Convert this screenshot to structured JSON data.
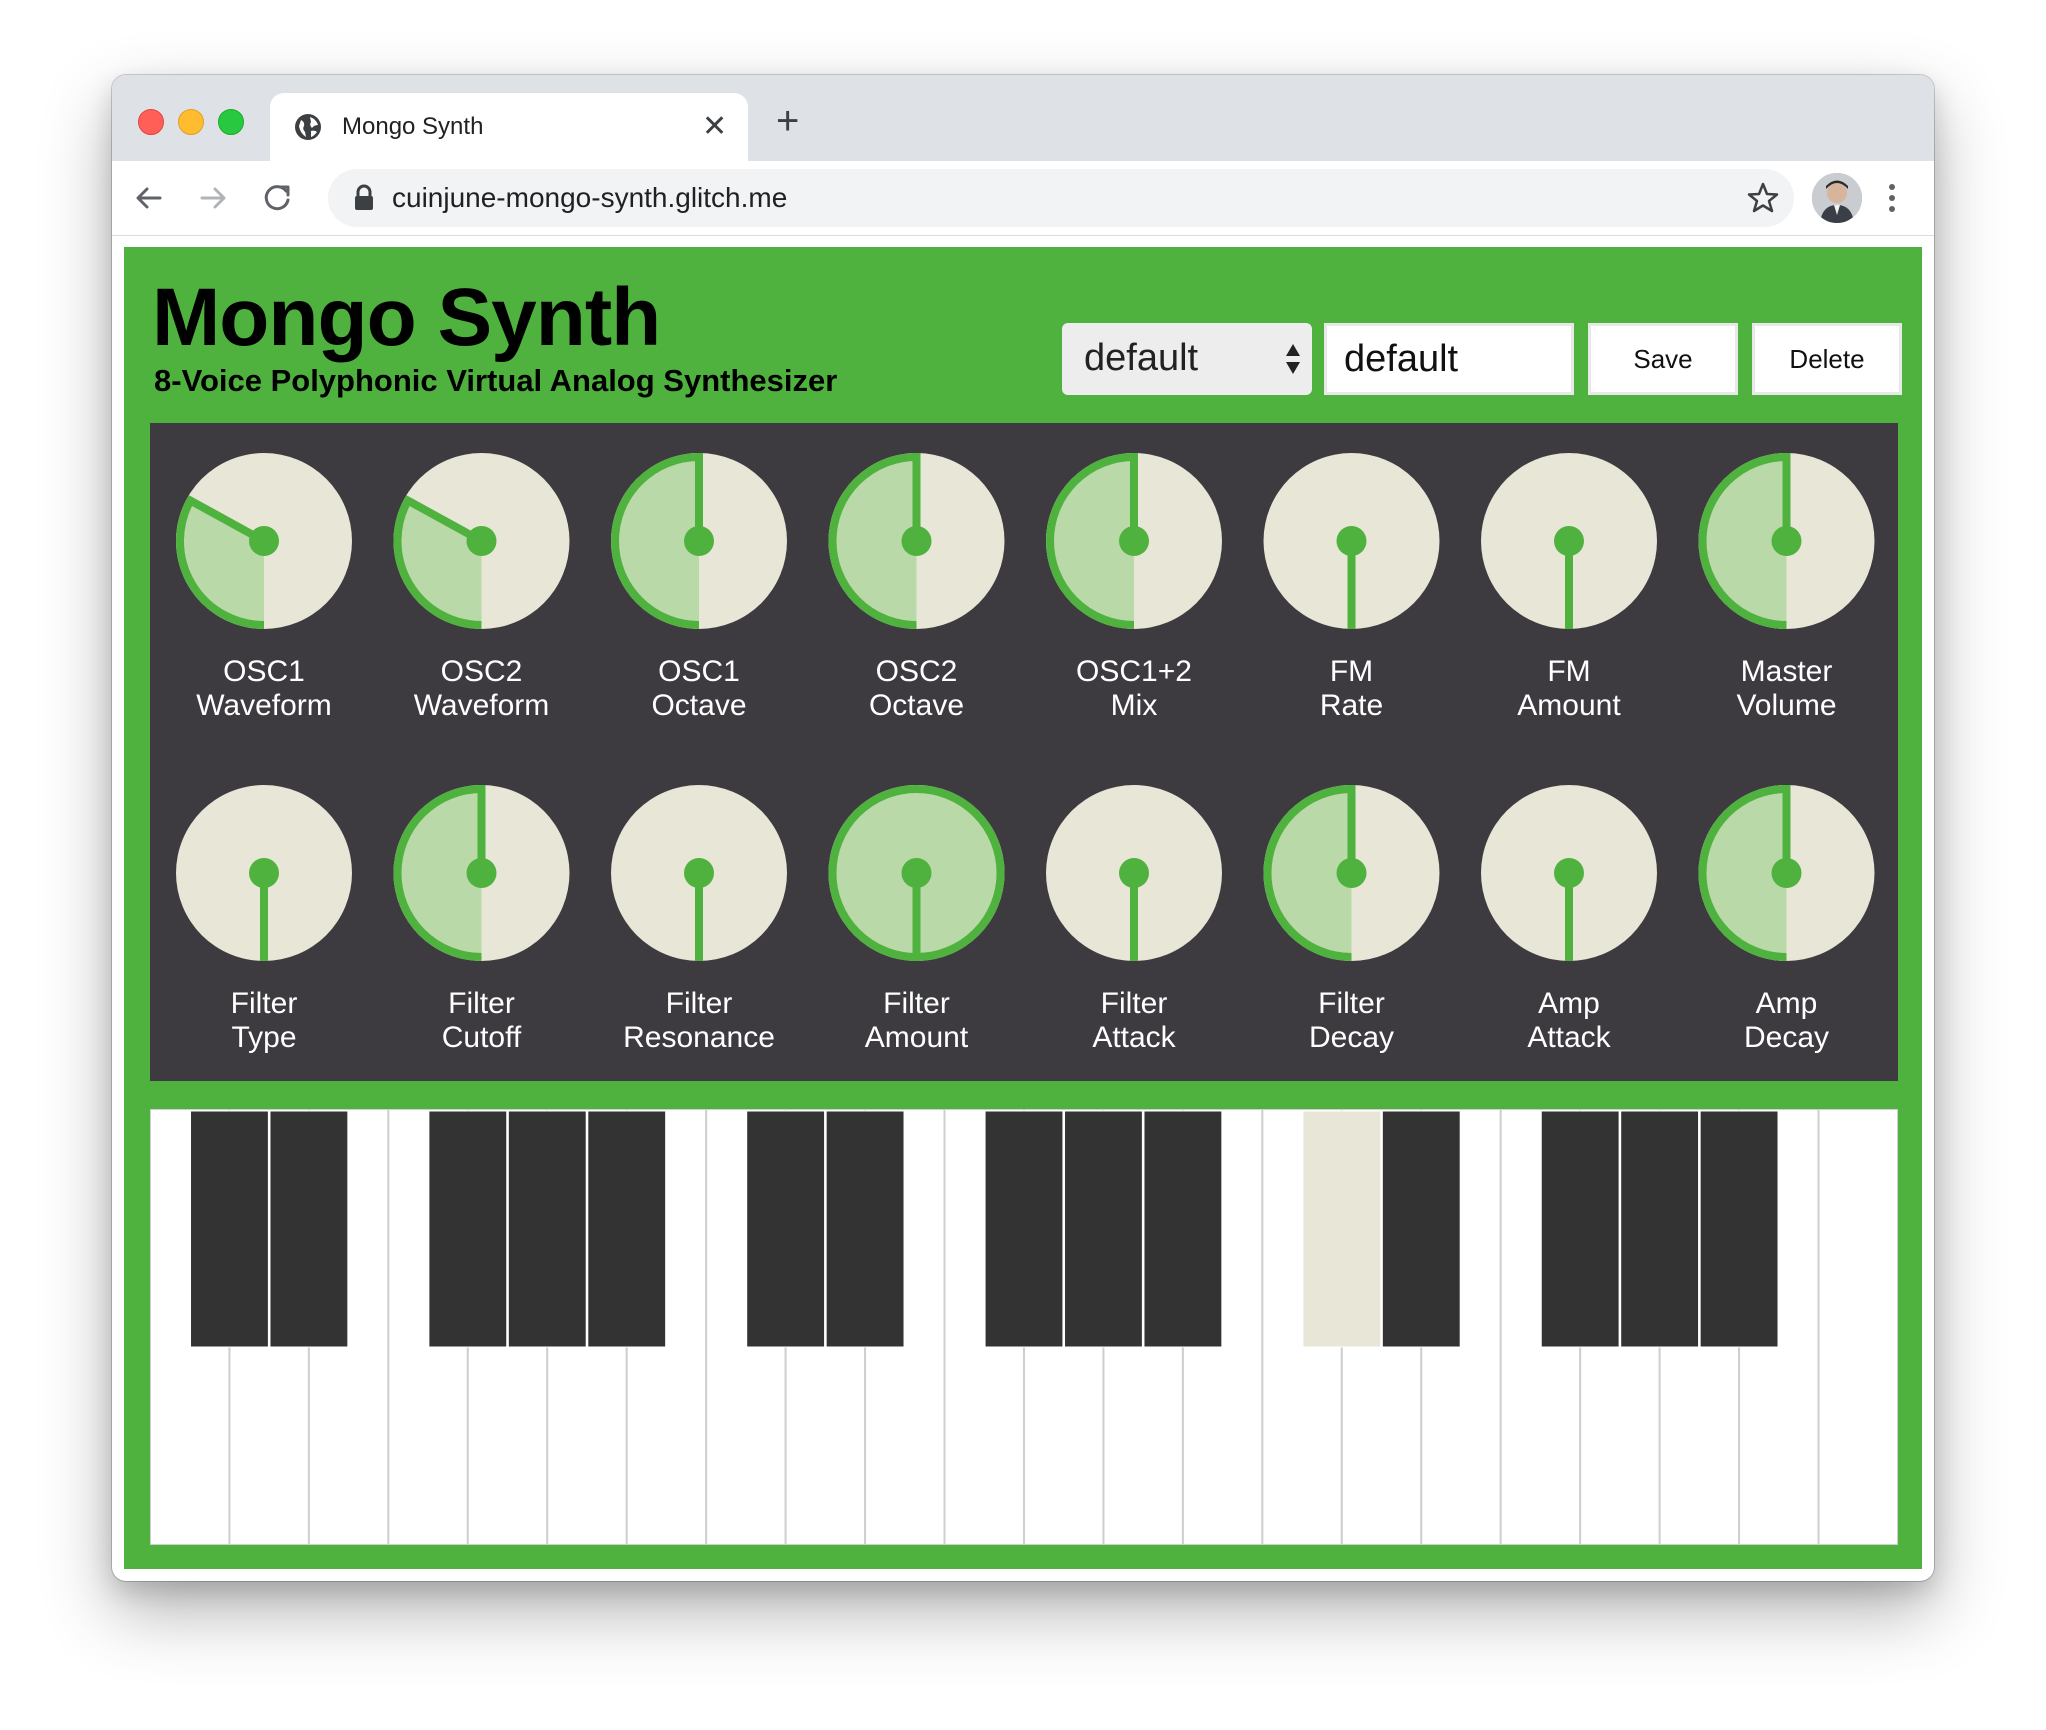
{
  "browser": {
    "tab_title": "Mongo Synth",
    "url": "cuinjune-mongo-synth.glitch.me"
  },
  "app": {
    "title": "Mongo Synth",
    "subtitle": "8-Voice Polyphonic Virtual Analog Synthesizer"
  },
  "presets": {
    "selected": "default",
    "name_value": "default",
    "save_label": "Save",
    "delete_label": "Delete"
  },
  "colors": {
    "accent": "#4fb23e",
    "knob_face": "#e8e6d6",
    "knob_fill": "#bad9a8",
    "panel": "#3d3b40",
    "black_key": "#333333",
    "pressed_key": "#e8e6d6"
  },
  "knobs": [
    {
      "line1": "OSC1",
      "line2": "Waveform",
      "value": 0.33
    },
    {
      "line1": "OSC2",
      "line2": "Waveform",
      "value": 0.33
    },
    {
      "line1": "OSC1",
      "line2": "Octave",
      "value": 0.5
    },
    {
      "line1": "OSC2",
      "line2": "Octave",
      "value": 0.5
    },
    {
      "line1": "OSC1+2",
      "line2": "Mix",
      "value": 0.5
    },
    {
      "line1": "FM",
      "line2": "Rate",
      "value": 0.0
    },
    {
      "line1": "FM",
      "line2": "Amount",
      "value": 0.0
    },
    {
      "line1": "Master",
      "line2": "Volume",
      "value": 0.5
    },
    {
      "line1": "Filter",
      "line2": "Type",
      "value": 0.0
    },
    {
      "line1": "Filter",
      "line2": "Cutoff",
      "value": 0.5
    },
    {
      "line1": "Filter",
      "line2": "Resonance",
      "value": 0.0
    },
    {
      "line1": "Filter",
      "line2": "Amount",
      "value": 1.0
    },
    {
      "line1": "Filter",
      "line2": "Attack",
      "value": 0.0
    },
    {
      "line1": "Filter",
      "line2": "Decay",
      "value": 0.5
    },
    {
      "line1": "Amp",
      "line2": "Attack",
      "value": 0.0
    },
    {
      "line1": "Amp",
      "line2": "Decay",
      "value": 0.5
    }
  ],
  "keyboard": {
    "white_keys": 22,
    "black_key_after_white": [
      0,
      1,
      3,
      4,
      5,
      7,
      8,
      10,
      11,
      12,
      14,
      15,
      17,
      18,
      19
    ],
    "pressed_black_key_index": 10
  }
}
